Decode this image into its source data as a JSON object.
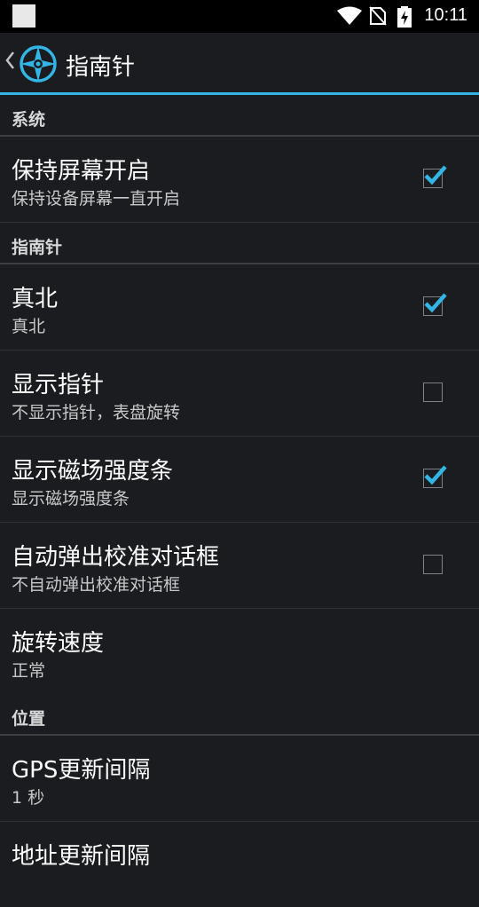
{
  "status_bar": {
    "time": "10:11",
    "icons": [
      "notification-square-icon",
      "wifi-icon",
      "no-sim-icon",
      "battery-charging-icon"
    ]
  },
  "action_bar": {
    "title": "指南针",
    "icons": [
      "back-chevron-icon",
      "compass-app-icon"
    ]
  },
  "colors": {
    "accent": "#33b5e5",
    "background": "#1a1c1f",
    "status_bar": "#000000"
  },
  "sections": {
    "system": {
      "header": "系统",
      "keep_screen_on": {
        "title": "保持屏幕开启",
        "summary": "保持设备屏幕一直开启",
        "checked": true
      }
    },
    "compass": {
      "header": "指南针",
      "true_north": {
        "title": "真北",
        "summary": "真北",
        "checked": true
      },
      "show_needle": {
        "title": "显示指针",
        "summary": "不显示指针，表盘旋转",
        "checked": false
      },
      "magnetic_bar": {
        "title": "显示磁场强度条",
        "summary": "显示磁场强度条",
        "checked": true
      },
      "auto_calibrate": {
        "title": "自动弹出校准对话框",
        "summary": "不自动弹出校准对话框",
        "checked": false
      },
      "rotation_speed": {
        "title": "旋转速度",
        "summary": "正常"
      }
    },
    "location": {
      "header": "位置",
      "gps_interval": {
        "title": "GPS更新间隔",
        "summary": "1 秒"
      },
      "address_interval": {
        "title": "地址更新间隔"
      }
    }
  }
}
